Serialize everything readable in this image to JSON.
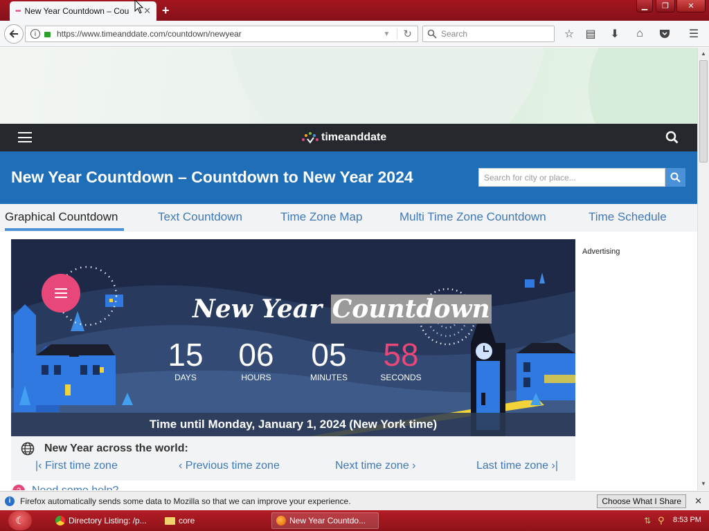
{
  "browser": {
    "tab_title": "New Year Countdown – Cou",
    "url": "https://www.timeanddate.com/countdown/newyear",
    "search_placeholder": "Search"
  },
  "site": {
    "logo_text": "timeanddate",
    "page_title": "New Year Countdown – Countdown to New Year 2024",
    "place_search_placeholder": "Search for city or place..."
  },
  "tabs": [
    {
      "label": "Graphical Countdown",
      "active": true
    },
    {
      "label": "Text Countdown",
      "active": false
    },
    {
      "label": "Time Zone Map",
      "active": false
    },
    {
      "label": "Multi Time Zone Countdown",
      "active": false
    },
    {
      "label": "Time Schedule",
      "active": false
    }
  ],
  "countdown": {
    "heading_part1": "New Year",
    "heading_part2": "Countdown",
    "days": "15",
    "days_label": "DAYS",
    "hours": "06",
    "hours_label": "HOURS",
    "minutes": "05",
    "minutes_label": "MINUTES",
    "seconds": "58",
    "seconds_label": "SECONDS",
    "caption": "Time until Monday, January 1, 2024 (New York time)"
  },
  "world": {
    "heading": "New Year across the world:",
    "first": "First time zone",
    "previous": "Previous time zone",
    "next": "Next time zone",
    "last": "Last time zone"
  },
  "help_text": "Need some help?",
  "advertising_label": "Advertising",
  "notification": {
    "text": "Firefox automatically sends some data to Mozilla so that we can improve your experience.",
    "button": "Choose What I Share"
  },
  "taskbar": {
    "items": [
      "Directory Listing: /p...",
      "core",
      "New Year Countdo..."
    ],
    "clock": "8:53 PM"
  },
  "colors": {
    "accent_blue": "#1f6eb8",
    "seconds_pink": "#e8477a",
    "taskbar_red": "#a4161f"
  }
}
